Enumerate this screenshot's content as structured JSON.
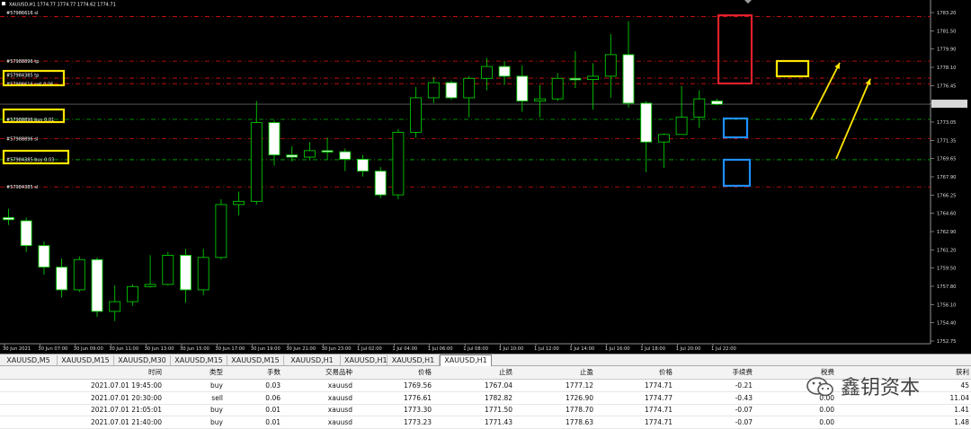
{
  "chart": {
    "symbol_title": "XAUUSD,H1  1774.77 1774.77 1774.62 1774.71",
    "current_price": "1774.71",
    "price_ticks": [
      "1783.20",
      "1781.50",
      "1779.90",
      "1778.10",
      "1776.45",
      "1774.71",
      "1773.05",
      "1771.35",
      "1769.65",
      "1767.90",
      "1766.25",
      "1764.60",
      "1762.90",
      "1761.20",
      "1759.50",
      "1757.80",
      "1756.10",
      "1754.40",
      "1752.75"
    ],
    "time_ticks": [
      "30 Jun 2021",
      "30 Jun 07:00",
      "30 Jun 09:00",
      "30 Jun 11:00",
      "30 Jun 13:00",
      "30 Jun 15:00",
      "30 Jun 17:00",
      "30 Jun 19:00",
      "30 Jun 21:00",
      "30 Jun 23:00",
      "1 Jul 02:00",
      "1 Jul 04:00",
      "1 Jul 06:00",
      "1 Jul 08:00",
      "1 Jul 10:00",
      "1 Jul 12:00",
      "1 Jul 14:00",
      "1 Jul 16:00",
      "1 Jul 18:00",
      "1 Jul 20:00",
      "1 Jul 22:00"
    ],
    "order_labels": {
      "top_sl": "#57986616 sl",
      "tp1": "#57988896 tp",
      "tp2_a": "#57984385 tp",
      "tp2_b": "#57986616 sell 0.06",
      "buy1": "#57988896 buy 0.01",
      "sl2": "#57988896 sl",
      "buy2": "#57984385 buy 0.03",
      "sl3": "#57984385 sl"
    },
    "colors": {
      "sl": "#ff2020",
      "buy": "#00cc00",
      "tp": "#ff2020",
      "annot_yellow": "#ffe600",
      "annot_red": "#e0202a",
      "annot_blue": "#1e90ff"
    }
  },
  "chart_data": {
    "type": "candlestick",
    "timeframe": "H1",
    "series": [
      {
        "name": "XAUUSD",
        "candles": [
          {
            "o": 1764.2,
            "h": 1765.0,
            "c": 1764.0,
            "l": 1763.5
          },
          {
            "o": 1763.9,
            "h": 1764.2,
            "c": 1761.6,
            "l": 1761.0
          },
          {
            "o": 1761.6,
            "h": 1762.0,
            "c": 1759.6,
            "l": 1758.9
          },
          {
            "o": 1759.6,
            "h": 1760.4,
            "c": 1757.5,
            "l": 1756.8
          },
          {
            "o": 1757.5,
            "h": 1760.6,
            "c": 1760.3,
            "l": 1757.3
          },
          {
            "o": 1760.3,
            "h": 1760.5,
            "c": 1755.5,
            "l": 1755.0
          },
          {
            "o": 1755.5,
            "h": 1757.9,
            "c": 1756.4,
            "l": 1754.6
          },
          {
            "o": 1756.4,
            "h": 1758.0,
            "c": 1757.8,
            "l": 1756.0
          },
          {
            "o": 1757.8,
            "h": 1760.7,
            "c": 1758.0,
            "l": 1757.7
          },
          {
            "o": 1758.0,
            "h": 1761.0,
            "c": 1760.7,
            "l": 1757.9
          },
          {
            "o": 1760.7,
            "h": 1761.3,
            "c": 1757.5,
            "l": 1756.3
          },
          {
            "o": 1757.5,
            "h": 1761.3,
            "c": 1760.5,
            "l": 1757.0
          },
          {
            "o": 1760.5,
            "h": 1765.9,
            "c": 1765.4,
            "l": 1760.3
          },
          {
            "o": 1765.4,
            "h": 1766.6,
            "c": 1765.7,
            "l": 1764.4
          },
          {
            "o": 1765.7,
            "h": 1775.0,
            "c": 1773.0,
            "l": 1765.4
          },
          {
            "o": 1773.0,
            "h": 1773.2,
            "c": 1770.0,
            "l": 1769.0
          },
          {
            "o": 1770.0,
            "h": 1770.8,
            "c": 1769.8,
            "l": 1769.4
          },
          {
            "o": 1769.8,
            "h": 1771.2,
            "c": 1770.4,
            "l": 1769.5
          },
          {
            "o": 1770.4,
            "h": 1771.6,
            "c": 1770.3,
            "l": 1769.6
          },
          {
            "o": 1770.3,
            "h": 1770.6,
            "c": 1769.6,
            "l": 1768.5
          },
          {
            "o": 1769.6,
            "h": 1770.0,
            "c": 1768.5,
            "l": 1768.0
          },
          {
            "o": 1768.5,
            "h": 1768.9,
            "c": 1766.3,
            "l": 1766.0
          },
          {
            "o": 1766.3,
            "h": 1772.4,
            "c": 1772.1,
            "l": 1765.9
          },
          {
            "o": 1772.1,
            "h": 1776.3,
            "c": 1775.3,
            "l": 1771.6
          },
          {
            "o": 1775.3,
            "h": 1777.2,
            "c": 1776.7,
            "l": 1774.8
          },
          {
            "o": 1776.7,
            "h": 1776.9,
            "c": 1775.3,
            "l": 1775.1
          },
          {
            "o": 1775.3,
            "h": 1777.3,
            "c": 1777.1,
            "l": 1773.5
          },
          {
            "o": 1777.1,
            "h": 1779.0,
            "c": 1778.2,
            "l": 1776.0
          },
          {
            "o": 1778.2,
            "h": 1778.7,
            "c": 1777.3,
            "l": 1776.5
          },
          {
            "o": 1777.3,
            "h": 1778.3,
            "c": 1775.0,
            "l": 1774.0
          },
          {
            "o": 1775.0,
            "h": 1776.5,
            "c": 1775.2,
            "l": 1773.5
          },
          {
            "o": 1775.2,
            "h": 1777.6,
            "c": 1777.1,
            "l": 1775.0
          },
          {
            "o": 1777.1,
            "h": 1779.6,
            "c": 1777.0,
            "l": 1776.2
          },
          {
            "o": 1777.0,
            "h": 1778.5,
            "c": 1777.3,
            "l": 1774.2
          },
          {
            "o": 1777.3,
            "h": 1781.2,
            "c": 1779.3,
            "l": 1775.3
          },
          {
            "o": 1779.3,
            "h": 1782.4,
            "c": 1774.8,
            "l": 1774.4
          },
          {
            "o": 1774.8,
            "h": 1775.0,
            "c": 1771.2,
            "l": 1768.4
          },
          {
            "o": 1771.2,
            "h": 1772.0,
            "c": 1771.9,
            "l": 1768.8
          },
          {
            "o": 1771.9,
            "h": 1776.4,
            "c": 1773.5,
            "l": 1772.0
          },
          {
            "o": 1773.5,
            "h": 1776.0,
            "c": 1775.2,
            "l": 1772.5
          },
          {
            "o": 1775.0,
            "h": 1775.2,
            "c": 1774.7,
            "l": 1774.6
          }
        ]
      }
    ],
    "ylim": [
      1752.0,
      1784.0
    ],
    "levels": [
      {
        "name": "#57986616 sl",
        "price": 1782.82,
        "color": "red"
      },
      {
        "name": "#57988896 tp",
        "price": 1778.7,
        "color": "red"
      },
      {
        "name": "#57984385 tp",
        "price": 1777.12,
        "color": "red"
      },
      {
        "name": "#57986616 sell 0.06",
        "price": 1776.61,
        "color": "red"
      },
      {
        "name": "#57988896 buy 0.01",
        "price": 1773.3,
        "color": "green"
      },
      {
        "name": "#57988896 sl",
        "price": 1771.5,
        "color": "red"
      },
      {
        "name": "#57984385 buy 0.03",
        "price": 1769.56,
        "color": "green"
      },
      {
        "name": "#57984385 sl",
        "price": 1767.04,
        "color": "red"
      }
    ]
  },
  "tabs": [
    "XAUUSD,M5",
    "XAUUSD,M15",
    "XAUUSD,M30",
    "XAUUSD,M15",
    "XAUUSD,M15",
    "XAUUSD,H1",
    "XAUUSD,H1",
    "XAUUSD,H1"
  ],
  "active_tab": "XAUUSD,H1",
  "table": {
    "headers": [
      "时间",
      "类型",
      "手数",
      "交易品种",
      "价格",
      "止损",
      "止盈",
      "价格",
      "手续费",
      "税费",
      "获利"
    ],
    "rows": [
      [
        "2021.07.01 19:45:00",
        "buy",
        "0.03",
        "xauusd",
        "1769.56",
        "1767.04",
        "1777.12",
        "1774.71",
        "-0.21",
        "",
        "45"
      ],
      [
        "2021.07.01 20:30:00",
        "sell",
        "0.06",
        "xauusd",
        "1776.61",
        "1782.82",
        "1726.90",
        "1774.77",
        "-0.43",
        "0.00",
        "11.04"
      ],
      [
        "2021.07.01 21:05:01",
        "buy",
        "0.01",
        "xauusd",
        "1773.30",
        "1771.50",
        "1778.70",
        "1774.71",
        "-0.07",
        "0.00",
        "1.41"
      ],
      [
        "2021.07.01 21:40:00",
        "buy",
        "0.01",
        "xauusd",
        "1773.23",
        "1771.43",
        "1778.63",
        "1774.71",
        "-0.07",
        "0.00",
        "1.48"
      ]
    ]
  },
  "watermark": "鑫钥资本"
}
